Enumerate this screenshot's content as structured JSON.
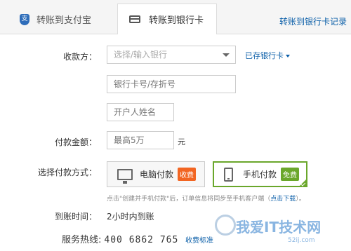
{
  "tabs": {
    "alipay": {
      "label": "转账到支付宝",
      "icon": "alipay-shield-icon"
    },
    "bank": {
      "label": "转账到银行卡",
      "icon": "bank-card-icon",
      "active": true
    }
  },
  "header": {
    "record_link": "转账到银行卡记录"
  },
  "form": {
    "payee_label": "收款方：",
    "bank_select_placeholder": "选择/输入银行",
    "saved_cards_link": "已存银行卡",
    "card_number_placeholder": "银行卡号/存折号",
    "account_name_placeholder": "开户人姓名",
    "amount_label": "付款金额：",
    "amount_placeholder": "最高5万",
    "amount_unit": "元",
    "pay_method_label": "选择付款方式：",
    "pay_options": [
      {
        "label": "电脑付款",
        "tag": "收费",
        "icon": "monitor-icon",
        "selected": false
      },
      {
        "label": "手机付款",
        "tag": "免费",
        "icon": "phone-icon",
        "selected": true
      }
    ],
    "hint_text": "点击\"创建并手机付款\"后，订单信息将同步至手机客户端（",
    "hint_link": "点击下载",
    "hint_end": "）。",
    "arrival_label": "到账时间：",
    "arrival_value": "2小时内到账",
    "hotline_label": "服务热线:",
    "hotline_number": "400 6862 765",
    "fee_link": "收费标准"
  },
  "watermark": {
    "text": "我爱IT技术网",
    "sub": "52ij.com"
  },
  "colors": {
    "link": "#0a5ea8",
    "selected_border": "#6aa72b",
    "charge_tag": "#f26522",
    "free_tag": "#6aa72b"
  }
}
